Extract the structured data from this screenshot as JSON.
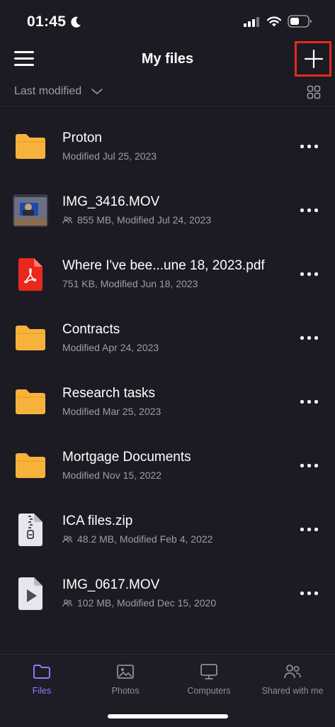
{
  "status_bar": {
    "time": "01:45"
  },
  "header": {
    "title": "My files"
  },
  "sort": {
    "label": "Last modified"
  },
  "files": [
    {
      "name": "Proton",
      "meta": "Modified Jul 25, 2023",
      "type": "folder-icon",
      "shared": false
    },
    {
      "name": "IMG_3416.MOV",
      "meta": "855 MB, Modified Jul 24, 2023",
      "type": "video-thumbnail",
      "shared": true
    },
    {
      "name": "Where I've bee...une 18, 2023.pdf",
      "meta": "751 KB, Modified Jun 18, 2023",
      "type": "pdf-icon",
      "shared": false
    },
    {
      "name": "Contracts",
      "meta": "Modified Apr 24, 2023",
      "type": "folder-icon",
      "shared": false
    },
    {
      "name": "Research tasks",
      "meta": "Modified Mar 25, 2023",
      "type": "folder-icon",
      "shared": false
    },
    {
      "name": "Mortgage Documents",
      "meta": "Modified Nov 15, 2022",
      "type": "folder-icon",
      "shared": false
    },
    {
      "name": "ICA files.zip",
      "meta": "48.2 MB, Modified Feb 4, 2022",
      "type": "zip-icon",
      "shared": true
    },
    {
      "name": "IMG_0617.MOV",
      "meta": "102 MB, Modified Dec 15, 2020",
      "type": "video-file-icon",
      "shared": true
    }
  ],
  "tabs": [
    {
      "label": "Files",
      "icon": "folder-icon",
      "active": true
    },
    {
      "label": "Photos",
      "icon": "photo-icon",
      "active": false
    },
    {
      "label": "Computers",
      "icon": "monitor-icon",
      "active": false
    },
    {
      "label": "Shared with me",
      "icon": "people-icon",
      "active": false
    }
  ],
  "colors": {
    "background": "#1c1b24",
    "folder": "#f7b23b",
    "pdf": "#e8281d",
    "accent": "#8c7bff",
    "highlight_box": "#e8281d"
  }
}
